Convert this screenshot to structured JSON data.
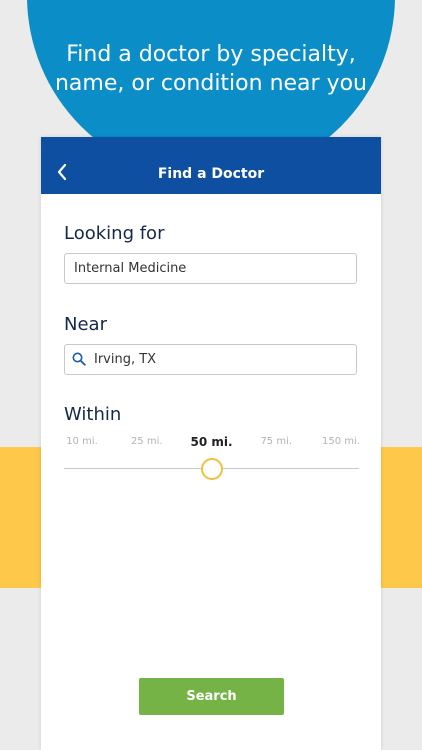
{
  "promo": {
    "headline_line1": "Find a doctor by specialty,",
    "headline_line2": "name, or condition near you"
  },
  "appbar": {
    "title": "Find a Doctor",
    "back_icon": "chevron-left-icon"
  },
  "form": {
    "looking_for": {
      "label": "Looking for",
      "value": "Internal Medicine"
    },
    "near": {
      "label": "Near",
      "value": "Irving, TX",
      "icon": "search-icon"
    },
    "within": {
      "label": "Within",
      "options": [
        "10 mi.",
        "25 mi.",
        "50 mi.",
        "75 mi.",
        "150 mi."
      ],
      "selected": "50 mi."
    }
  },
  "search_button": {
    "label": "Search"
  },
  "colors": {
    "background": "#ebebeb",
    "promo_circle": "#0b8ec8",
    "accent_band": "#fec84a",
    "appbar": "#0e4fa1",
    "label_text": "#15284b",
    "slider_thumb_border": "#f0c13e",
    "search_button": "#76b347"
  }
}
